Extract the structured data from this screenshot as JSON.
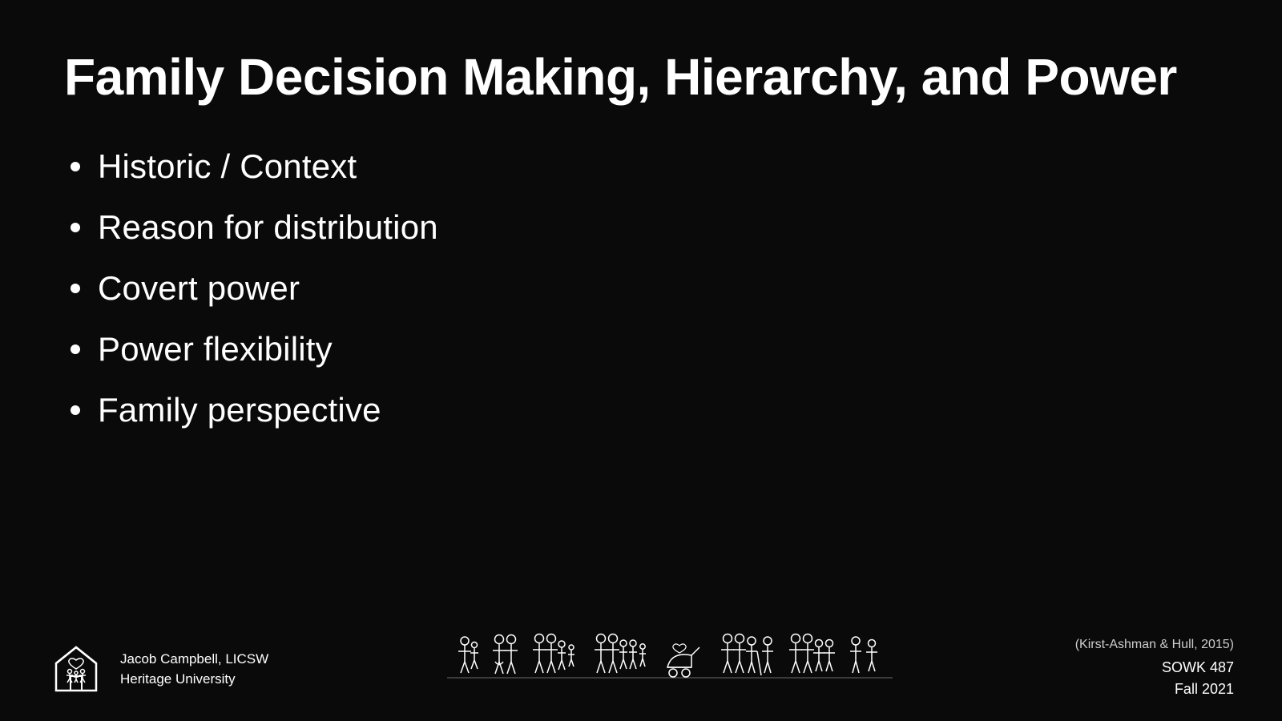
{
  "slide": {
    "title": "Family Decision Making, Hierarchy, and Power",
    "bullets": [
      "Historic / Context",
      "Reason for distribution",
      "Covert power",
      "Power flexibility",
      "Family perspective"
    ]
  },
  "footer": {
    "author_name": "Jacob Campbell, LICSW",
    "author_org": "Heritage University",
    "citation": "(Kirst-Ashman & Hull, 2015)",
    "course": "SOWK 487",
    "term": "Fall 2021"
  }
}
